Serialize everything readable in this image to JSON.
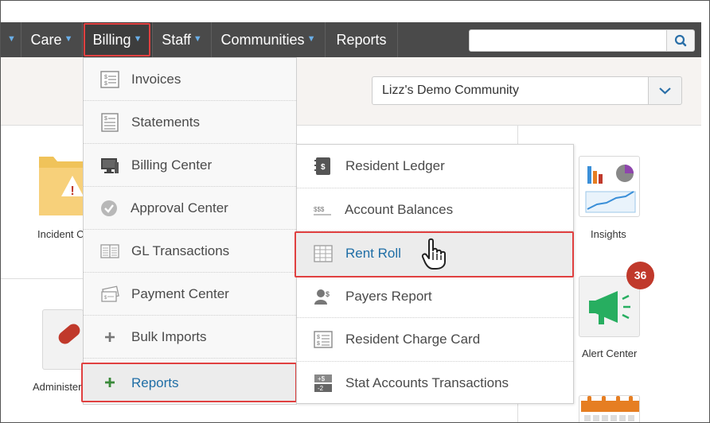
{
  "nav": {
    "items": [
      {
        "label": "Care",
        "caret": true
      },
      {
        "label": "Billing",
        "caret": true
      },
      {
        "label": "Staff",
        "caret": true
      },
      {
        "label": "Communities",
        "caret": true
      },
      {
        "label": "Reports",
        "caret": false
      }
    ],
    "search": {
      "value": "",
      "placeholder": ""
    }
  },
  "community": {
    "selected": "Lizz's Demo Community"
  },
  "background": {
    "incident_label": "Incident C",
    "insights_label": "Insights",
    "alert_label": "Alert Center",
    "alert_count": "36",
    "administer_label": "Administer"
  },
  "billing_menu": {
    "items": [
      {
        "label": "Invoices",
        "icon": "invoice-icon"
      },
      {
        "label": "Statements",
        "icon": "statement-icon"
      },
      {
        "label": "Billing Center",
        "icon": "computer-icon"
      },
      {
        "label": "Approval Center",
        "icon": "check-circle-icon"
      },
      {
        "label": "GL Transactions",
        "icon": "ledger-book-icon"
      },
      {
        "label": "Payment Center",
        "icon": "payment-icon"
      },
      {
        "label": "Bulk Imports",
        "icon": "plus-icon"
      },
      {
        "label": "Reports",
        "icon": "plus-icon"
      }
    ]
  },
  "reports_menu": {
    "items": [
      {
        "label": "Resident Ledger",
        "icon": "ledger-icon"
      },
      {
        "label": "Account Balances",
        "icon": "dollar-signs-icon"
      },
      {
        "label": "Rent Roll",
        "icon": "table-icon"
      },
      {
        "label": "Payers Report",
        "icon": "payers-icon"
      },
      {
        "label": "Resident Charge Card",
        "icon": "charge-card-icon"
      },
      {
        "label": "Stat Accounts Transactions",
        "icon": "stat-accounts-icon"
      }
    ]
  },
  "colors": {
    "nav_bg": "#4a4a4a",
    "highlight": "#e04040",
    "link": "#1f6ea6",
    "badge": "#c0392b"
  }
}
